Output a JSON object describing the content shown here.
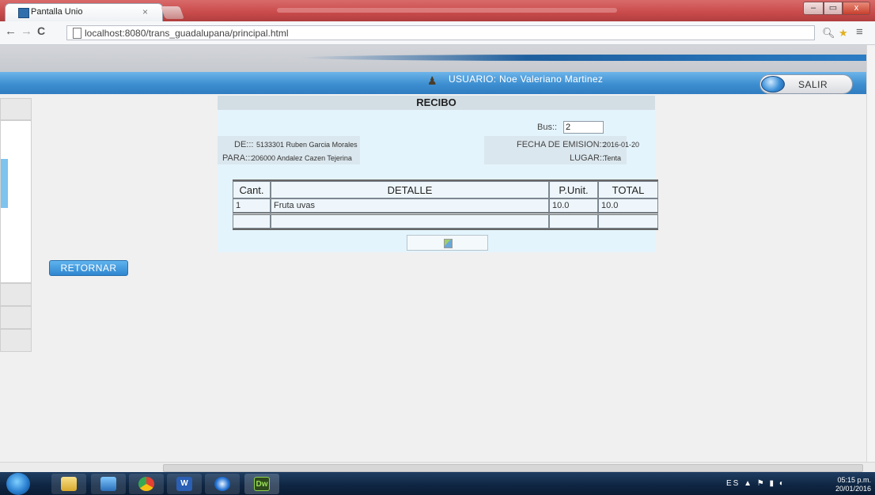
{
  "browser": {
    "tab_title": "Pantalla Unio",
    "tab_close": "×",
    "url": "localhost:8080/trans_guadalupana/principal.html",
    "nav_back": "←",
    "nav_forward": "→",
    "nav_reload": "C",
    "win_min": "–",
    "win_max": "▭",
    "win_close": "x"
  },
  "header": {
    "user_label": "USUARIO: Noe Valeriano Martinez",
    "salir_label": "SALIR"
  },
  "recibo": {
    "title": "RECIBO",
    "bus_label": "Bus::",
    "bus_value": "2",
    "de_label": "DE:::",
    "de_value": "5133301 Ruben Garcia Morales",
    "para_label": "PARA:::",
    "para_value": "206000 Andalez Cazen Tejerina",
    "fecha_label": "FECHA DE EMISION:::",
    "fecha_value": "2016-01-20",
    "lugar_label": "LUGAR:::",
    "lugar_value": "Tenta",
    "table": {
      "headers": [
        "Cant.",
        "DETALLE",
        "P.Unit.",
        "TOTAL"
      ],
      "rows": [
        [
          "1",
          "Fruta uvas",
          "10.0",
          "10.0"
        ]
      ]
    }
  },
  "left": {
    "retornar_label": "RETORNAR"
  },
  "taskbar": {
    "dw_label": "Dw",
    "word_label": "W",
    "tray_lang": "ES",
    "time": "05:15 p.m.",
    "date": "20/01/2016"
  },
  "icons": [
    "back-arrow-icon",
    "forward-arrow-icon",
    "reload-icon",
    "page-icon",
    "zoom-icon",
    "star-icon",
    "menu-icon",
    "user-icon",
    "salir-ball-icon",
    "broken-image-icon",
    "start-orb-icon",
    "folder-icon",
    "media-player-icon",
    "chrome-icon",
    "word-icon",
    "ie-icon",
    "dreamweaver-icon"
  ]
}
